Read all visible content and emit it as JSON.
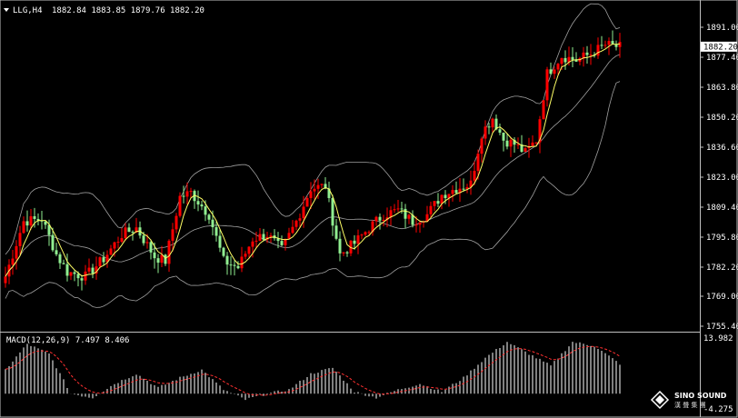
{
  "header": {
    "symbol": "LLG,H4",
    "ohlc": "1882.84 1883.85 1879.76 1882.20",
    "arrow_icon": "triangle-down-icon"
  },
  "macd": {
    "label": "MACD(12,26,9) 7.497 8.406",
    "axis_top": "13.982",
    "axis_bottom": "-4.275"
  },
  "watermark": {
    "brand": "SINO SOUND",
    "sub": "漢 聲 集 團",
    "icon": "diamond-logo-icon"
  },
  "colors": {
    "background": "#000000",
    "bull": "#ff0000",
    "bear": "#90ee90",
    "ma": "#ffff66",
    "bands": "#a0a0a0",
    "macd_signal": "#ff3030",
    "macd_hist": "#ffffff",
    "price_tag_bg": "#ffffff"
  },
  "chart_data": [
    {
      "type": "candlestick",
      "title": "LLG,H4",
      "current_price": "1882.20",
      "y_ticks": [
        "1891.00",
        "1877.40",
        "1863.80",
        "1850.20",
        "1836.60",
        "1823.00",
        "1809.40",
        "1795.80",
        "1782.20",
        "1769.00",
        "1755.40"
      ],
      "ylim": [
        1755.4,
        1891.0
      ],
      "grid": false,
      "indicators": [
        "Bollinger Bands",
        "Moving Average"
      ],
      "waypoints": [
        [
          0,
          1778
        ],
        [
          5,
          1803
        ],
        [
          10,
          1804
        ],
        [
          14,
          1788
        ],
        [
          17,
          1780
        ],
        [
          22,
          1778
        ],
        [
          27,
          1786
        ],
        [
          32,
          1797
        ],
        [
          36,
          1800
        ],
        [
          41,
          1787
        ],
        [
          44,
          1785
        ],
        [
          48,
          1814
        ],
        [
          51,
          1816
        ],
        [
          56,
          1806
        ],
        [
          60,
          1785
        ],
        [
          64,
          1782
        ],
        [
          68,
          1795
        ],
        [
          72,
          1797
        ],
        [
          76,
          1790
        ],
        [
          80,
          1803
        ],
        [
          84,
          1818
        ],
        [
          88,
          1819
        ],
        [
          92,
          1788
        ],
        [
          96,
          1793
        ],
        [
          100,
          1800
        ],
        [
          104,
          1806
        ],
        [
          108,
          1808
        ],
        [
          112,
          1803
        ],
        [
          116,
          1806
        ],
        [
          120,
          1815
        ],
        [
          124,
          1818
        ],
        [
          128,
          1820
        ],
        [
          131,
          1843
        ],
        [
          134,
          1850
        ],
        [
          137,
          1840
        ],
        [
          140,
          1838
        ],
        [
          143,
          1834
        ],
        [
          146,
          1840
        ],
        [
          149,
          1870
        ],
        [
          153,
          1878
        ],
        [
          157,
          1876
        ],
        [
          161,
          1879
        ],
        [
          165,
          1883
        ],
        [
          169,
          1882
        ]
      ]
    },
    {
      "type": "macd",
      "title": "MACD(12,26,9) 7.497 8.406",
      "ylim": [
        -4.275,
        13.982
      ],
      "waypoints": [
        [
          0,
          6
        ],
        [
          6,
          12.5
        ],
        [
          12,
          10
        ],
        [
          18,
          0
        ],
        [
          24,
          -1
        ],
        [
          30,
          2.5
        ],
        [
          36,
          5
        ],
        [
          42,
          1.5
        ],
        [
          48,
          4
        ],
        [
          54,
          6
        ],
        [
          60,
          1
        ],
        [
          66,
          -1.5
        ],
        [
          72,
          0
        ],
        [
          78,
          1
        ],
        [
          84,
          5
        ],
        [
          90,
          6.5
        ],
        [
          96,
          0.5
        ],
        [
          102,
          -1
        ],
        [
          108,
          1
        ],
        [
          114,
          2.5
        ],
        [
          120,
          0.5
        ],
        [
          126,
          4
        ],
        [
          132,
          9
        ],
        [
          138,
          13
        ],
        [
          144,
          10
        ],
        [
          150,
          7
        ],
        [
          156,
          13
        ],
        [
          162,
          12
        ],
        [
          169,
          7.5
        ]
      ]
    }
  ]
}
